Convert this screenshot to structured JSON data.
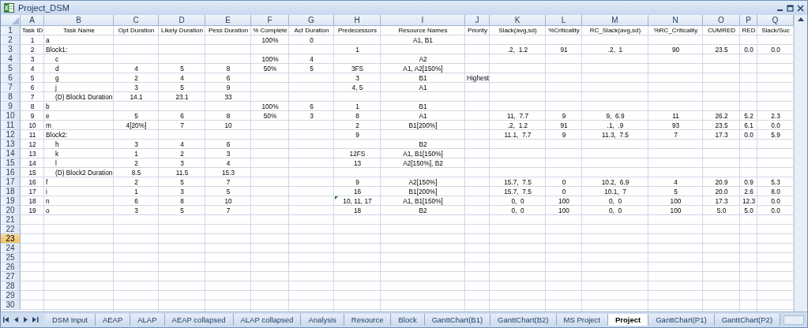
{
  "window": {
    "title": "Project_DSM"
  },
  "columns": [
    {
      "letter": "A",
      "heading": "Task ID"
    },
    {
      "letter": "B",
      "heading": "Task Name"
    },
    {
      "letter": "C",
      "heading": "Opt Duration"
    },
    {
      "letter": "D",
      "heading": "Likely Duration"
    },
    {
      "letter": "E",
      "heading": "Pess Duration"
    },
    {
      "letter": "F",
      "heading": "% Complete"
    },
    {
      "letter": "G",
      "heading": "Act Duration"
    },
    {
      "letter": "H",
      "heading": "Predecessors"
    },
    {
      "letter": "I",
      "heading": "Resource Names"
    },
    {
      "letter": "J",
      "heading": "Priority"
    },
    {
      "letter": "K",
      "heading": "Slack(avg,sd)"
    },
    {
      "letter": "L",
      "heading": "%Criticality"
    },
    {
      "letter": "M",
      "heading": "RC_Slack(avg,sd)"
    },
    {
      "letter": "N",
      "heading": "%RC_Criticality"
    },
    {
      "letter": "O",
      "heading": "CUMRED"
    },
    {
      "letter": "P",
      "heading": "RED"
    },
    {
      "letter": "Q",
      "heading": "Slack/Suc"
    }
  ],
  "row_numbers": [
    {
      "label": "1",
      "selected": false
    },
    {
      "label": "2",
      "selected": false
    },
    {
      "label": "3",
      "selected": false
    },
    {
      "label": "4",
      "selected": false
    },
    {
      "label": "5",
      "selected": false
    },
    {
      "label": "6",
      "selected": false
    },
    {
      "label": "7",
      "selected": false
    },
    {
      "label": "8",
      "selected": false
    },
    {
      "label": "9",
      "selected": false
    },
    {
      "label": "10",
      "selected": false
    },
    {
      "label": "11",
      "selected": false
    },
    {
      "label": "12",
      "selected": false
    },
    {
      "label": "13",
      "selected": false
    },
    {
      "label": "14",
      "selected": false
    },
    {
      "label": "15",
      "selected": false
    },
    {
      "label": "16",
      "selected": false
    },
    {
      "label": "17",
      "selected": false
    },
    {
      "label": "18",
      "selected": false
    },
    {
      "label": "19",
      "selected": false
    },
    {
      "label": "20",
      "selected": false
    },
    {
      "label": "21",
      "selected": false
    },
    {
      "label": "22",
      "selected": false
    },
    {
      "label": "23",
      "selected": true
    },
    {
      "label": "24",
      "selected": false
    },
    {
      "label": "25",
      "selected": false
    },
    {
      "label": "26",
      "selected": false
    },
    {
      "label": "27",
      "selected": false
    },
    {
      "label": "28",
      "selected": false
    },
    {
      "label": "29",
      "selected": false
    },
    {
      "label": "30",
      "selected": false
    }
  ],
  "rows": [
    {
      "flagged": false,
      "cells": [
        "1",
        "a",
        null,
        null,
        null,
        "100%",
        "0",
        null,
        "A1, B1",
        null,
        null,
        null,
        null,
        null,
        null,
        null,
        null
      ]
    },
    {
      "flagged": false,
      "cells": [
        "2",
        "Block1:",
        null,
        null,
        null,
        null,
        null,
        "1",
        null,
        null,
        ".2,  1.2",
        "91",
        ".2,  1",
        "90",
        "23.5",
        "0.0",
        "0.0"
      ],
      "children": [
        {
          "flagged": false,
          "cells": [
            "3",
            "c",
            null,
            null,
            null,
            "100%",
            "4",
            null,
            "A2",
            null,
            null,
            null,
            null,
            null,
            null,
            null,
            null
          ]
        },
        {
          "flagged": false,
          "cells": [
            "4",
            "d",
            "4",
            "5",
            "8",
            "50%",
            "5",
            "3FS",
            "A1, A2[150%]",
            null,
            null,
            null,
            null,
            null,
            null,
            null,
            null
          ]
        },
        {
          "flagged": false,
          "cells": [
            "5",
            "g",
            "2",
            "4",
            "6",
            null,
            null,
            "3",
            "B1",
            "Highest",
            null,
            null,
            null,
            null,
            null,
            null,
            null
          ]
        },
        {
          "flagged": false,
          "cells": [
            "6",
            "j",
            "3",
            "5",
            "9",
            null,
            null,
            "4, 5",
            "A1",
            null,
            null,
            null,
            null,
            null,
            null,
            null,
            null
          ]
        },
        {
          "flagged": false,
          "cells": [
            "7",
            "(D) Block1 Duration",
            "14.1",
            "23.1",
            "33",
            null,
            null,
            null,
            null,
            null,
            null,
            null,
            null,
            null,
            null,
            null,
            null
          ]
        }
      ]
    },
    {
      "flagged": false,
      "cells": [
        "8",
        "b",
        null,
        null,
        null,
        "100%",
        "6",
        "1",
        "B1",
        null,
        null,
        null,
        null,
        null,
        null,
        null,
        null
      ]
    },
    {
      "flagged": false,
      "cells": [
        "9",
        "e",
        "5",
        "6",
        "8",
        "50%",
        "3",
        "8",
        "A1",
        null,
        "11,  7.7",
        "9",
        "9,  6.9",
        "11",
        "26.2",
        "5.2",
        "2.3"
      ]
    },
    {
      "flagged": false,
      "cells": [
        "10",
        "m",
        "4[20%]",
        "7",
        "10",
        null,
        null,
        "2",
        "B1[200%]",
        null,
        ".2,  1.2",
        "91",
        ".1,  .9",
        "93",
        "23.5",
        "6.1",
        "0.0"
      ]
    },
    {
      "flagged": false,
      "cells": [
        "11",
        "Block2:",
        null,
        null,
        null,
        null,
        null,
        "9",
        null,
        null,
        "11.1,  7.7",
        "9",
        "11.3,  7.5",
        "7",
        "17.3",
        "0.0",
        "5.9"
      ],
      "children": [
        {
          "flagged": false,
          "cells": [
            "12",
            "h",
            "3",
            "4",
            "6",
            null,
            null,
            null,
            "B2",
            null,
            null,
            null,
            null,
            null,
            null,
            null,
            null
          ]
        },
        {
          "flagged": false,
          "cells": [
            "13",
            "k",
            "1",
            "2",
            "3",
            null,
            null,
            "12FS",
            "A1, B1[150%]",
            null,
            null,
            null,
            null,
            null,
            null,
            null,
            null
          ]
        },
        {
          "flagged": false,
          "cells": [
            "14",
            "l",
            "2",
            "3",
            "4",
            null,
            null,
            "13",
            "A2[150%], B2",
            null,
            null,
            null,
            null,
            null,
            null,
            null,
            null
          ]
        },
        {
          "flagged": false,
          "cells": [
            "15",
            "(D) Block2 Duration",
            "8.5",
            "11.5",
            "15.3",
            null,
            null,
            null,
            null,
            null,
            null,
            null,
            null,
            null,
            null,
            null,
            null
          ]
        }
      ]
    },
    {
      "flagged": false,
      "cells": [
        "16",
        "f",
        "2",
        "5",
        "7",
        null,
        null,
        "9",
        "A2[150%]",
        null,
        "15.7,  7.5",
        "0",
        "10.2,  6.9",
        "4",
        "20.9",
        "0.9",
        "5.3"
      ]
    },
    {
      "flagged": false,
      "cells": [
        "17",
        "i",
        "1",
        "3",
        "5",
        null,
        null,
        "16",
        "B1[200%]",
        null,
        "15.7,  7.5",
        "0",
        "10.1,  7",
        "5",
        "20.0",
        "2.6",
        "8.0"
      ]
    },
    {
      "flagged": true,
      "cells": [
        "18",
        "n",
        "6",
        "8",
        "10",
        null,
        null,
        "10, 11, 17",
        "A1, B1[150%]",
        null,
        "0,  0",
        "100",
        "0,  0",
        "100",
        "17.3",
        "12.3",
        "0.0"
      ]
    },
    {
      "flagged": false,
      "cells": [
        "19",
        "o",
        "3",
        "5",
        "7",
        null,
        null,
        "18",
        "B2",
        null,
        "0,  0",
        "100",
        "0,  0",
        "100",
        "5.0",
        "5.0",
        "0.0"
      ]
    }
  ],
  "tabs": [
    {
      "label": "DSM Input",
      "selected": false
    },
    {
      "label": "AEAP",
      "selected": false
    },
    {
      "label": "ALAP",
      "selected": false
    },
    {
      "label": "AEAP collapsed",
      "selected": false
    },
    {
      "label": "ALAP collapsed",
      "selected": false
    },
    {
      "label": "Analysis",
      "selected": false
    },
    {
      "label": "Resource",
      "selected": false
    },
    {
      "label": "Block",
      "selected": false
    },
    {
      "label": "GanttChart(B1)",
      "selected": false
    },
    {
      "label": "GanttChart(B2)",
      "selected": false
    },
    {
      "label": "MS Project",
      "selected": false
    },
    {
      "label": "Project",
      "selected": true
    },
    {
      "label": "GanttChart(P1)",
      "selected": false
    },
    {
      "label": "GanttChart(P2)",
      "selected": false
    }
  ]
}
